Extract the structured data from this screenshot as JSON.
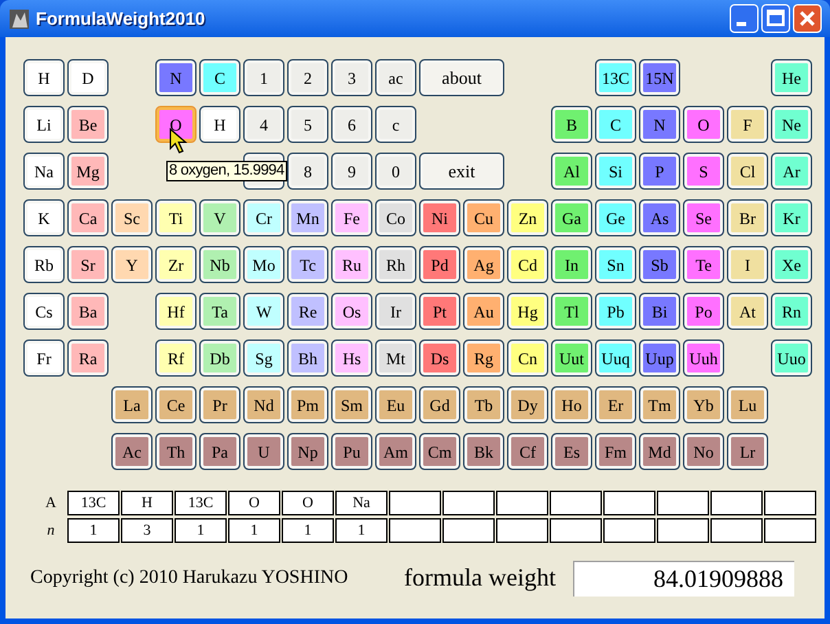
{
  "window": {
    "title": "FormulaWeight2010"
  },
  "button_rows": [
    [
      {
        "label": "H",
        "color": "#ffffff",
        "selected": false
      },
      {
        "label": "D",
        "color": "#ffffff",
        "selected": false
      },
      null,
      {
        "label": "N",
        "color": "#7878ff",
        "selected": false
      },
      {
        "label": "C",
        "color": "#70ffff",
        "selected": false
      },
      {
        "label": "1",
        "color": "#eeeeea",
        "selected": false
      },
      {
        "label": "2",
        "color": "#eeeeea",
        "selected": false
      },
      {
        "label": "3",
        "color": "#eeeeea",
        "selected": false
      },
      {
        "label": "ac",
        "color": "#eeeeea",
        "selected": false
      },
      {
        "label": "about",
        "kind": "wide",
        "color": "#f4f3ee",
        "selected": false
      },
      null,
      null,
      {
        "label": "13C",
        "color": "#70ffff",
        "selected": false
      },
      {
        "label": "15N",
        "color": "#7878ff",
        "selected": false
      },
      null,
      null,
      {
        "label": "He",
        "color": "#70ffd0",
        "selected": false
      }
    ],
    [
      {
        "label": "Li",
        "color": "#ffffff",
        "selected": false
      },
      {
        "label": "Be",
        "color": "#ffb8b8",
        "selected": false
      },
      null,
      {
        "label": "O",
        "color": "#ff70ff",
        "selected": true,
        "tooltip": "8 oxygen, 15.9994"
      },
      {
        "label": "H",
        "color": "#ffffff",
        "selected": false
      },
      {
        "label": "4",
        "color": "#eeeeea",
        "selected": false
      },
      {
        "label": "5",
        "color": "#eeeeea",
        "selected": false
      },
      {
        "label": "6",
        "color": "#eeeeea",
        "selected": false
      },
      {
        "label": "c",
        "color": "#eeeeea",
        "selected": false
      },
      null,
      null,
      null,
      {
        "label": "B",
        "color": "#70f070",
        "selected": false
      },
      {
        "label": "C",
        "color": "#70ffff",
        "selected": false
      },
      {
        "label": "N",
        "color": "#7878ff",
        "selected": false
      },
      {
        "label": "O",
        "color": "#ff70ff",
        "selected": false
      },
      {
        "label": "F",
        "color": "#f0e0a0",
        "selected": false
      },
      {
        "label": "Ne",
        "color": "#70ffd0",
        "selected": false
      }
    ],
    [
      {
        "label": "Na",
        "color": "#ffffff",
        "selected": false
      },
      {
        "label": "Mg",
        "color": "#ffb8b8",
        "selected": false
      },
      null,
      null,
      null,
      {
        "kind": "covered",
        "color": "#eeeeea",
        "selected": false
      },
      {
        "label": "8",
        "color": "#eeeeea",
        "selected": false
      },
      {
        "label": "9",
        "color": "#eeeeea",
        "selected": false
      },
      {
        "label": "0",
        "color": "#eeeeea",
        "selected": false
      },
      {
        "label": "exit",
        "kind": "wide",
        "color": "#f4f3ee",
        "selected": false
      },
      null,
      {
        "label": "Al",
        "color": "#70f070",
        "selected": false
      },
      {
        "label": "Si",
        "color": "#70ffff",
        "selected": false
      },
      {
        "label": "P",
        "color": "#7878ff",
        "selected": false
      },
      {
        "label": "S",
        "color": "#ff70ff",
        "selected": false
      },
      {
        "label": "Cl",
        "color": "#f0e0a0",
        "selected": false
      },
      {
        "label": "Ar",
        "color": "#70ffd0",
        "selected": false
      }
    ],
    [
      {
        "label": "K",
        "color": "#ffffff",
        "selected": false
      },
      {
        "label": "Ca",
        "color": "#ffb8b8",
        "selected": false
      },
      {
        "label": "Sc",
        "color": "#ffd8b0",
        "selected": false
      },
      {
        "label": "Ti",
        "color": "#ffffb0",
        "selected": false
      },
      {
        "label": "V",
        "color": "#b0f0b0",
        "selected": false
      },
      {
        "label": "Cr",
        "color": "#c0ffff",
        "selected": false
      },
      {
        "label": "Mn",
        "color": "#c0c0ff",
        "selected": false
      },
      {
        "label": "Fe",
        "color": "#ffc0ff",
        "selected": false
      },
      {
        "label": "Co",
        "color": "#e0e0e0",
        "selected": false
      },
      {
        "label": "Ni",
        "color": "#ff7878",
        "selected": false
      },
      {
        "label": "Cu",
        "color": "#ffb070",
        "selected": false
      },
      {
        "label": "Zn",
        "color": "#ffff80",
        "selected": false
      },
      {
        "label": "Ga",
        "color": "#70f070",
        "selected": false
      },
      {
        "label": "Ge",
        "color": "#70ffff",
        "selected": false
      },
      {
        "label": "As",
        "color": "#7878ff",
        "selected": false
      },
      {
        "label": "Se",
        "color": "#ff70ff",
        "selected": false
      },
      {
        "label": "Br",
        "color": "#f0e0a0",
        "selected": false
      },
      {
        "label": "Kr",
        "color": "#70ffd0",
        "selected": false
      }
    ],
    [
      {
        "label": "Rb",
        "color": "#ffffff",
        "selected": false
      },
      {
        "label": "Sr",
        "color": "#ffb8b8",
        "selected": false
      },
      {
        "label": "Y",
        "color": "#ffd8b0",
        "selected": false
      },
      {
        "label": "Zr",
        "color": "#ffffb0",
        "selected": false
      },
      {
        "label": "Nb",
        "color": "#b0f0b0",
        "selected": false
      },
      {
        "label": "Mo",
        "color": "#c0ffff",
        "selected": false
      },
      {
        "label": "Tc",
        "color": "#c0c0ff",
        "selected": false
      },
      {
        "label": "Ru",
        "color": "#ffc0ff",
        "selected": false
      },
      {
        "label": "Rh",
        "color": "#e0e0e0",
        "selected": false
      },
      {
        "label": "Pd",
        "color": "#ff7878",
        "selected": false
      },
      {
        "label": "Ag",
        "color": "#ffb070",
        "selected": false
      },
      {
        "label": "Cd",
        "color": "#ffff80",
        "selected": false
      },
      {
        "label": "In",
        "color": "#70f070",
        "selected": false
      },
      {
        "label": "Sn",
        "color": "#70ffff",
        "selected": false
      },
      {
        "label": "Sb",
        "color": "#7878ff",
        "selected": false
      },
      {
        "label": "Te",
        "color": "#ff70ff",
        "selected": false
      },
      {
        "label": "I",
        "color": "#f0e0a0",
        "selected": false
      },
      {
        "label": "Xe",
        "color": "#70ffd0",
        "selected": false
      }
    ],
    [
      {
        "label": "Cs",
        "color": "#ffffff",
        "selected": false
      },
      {
        "label": "Ba",
        "color": "#ffb8b8",
        "selected": false
      },
      null,
      {
        "label": "Hf",
        "color": "#ffffb0",
        "selected": false
      },
      {
        "label": "Ta",
        "color": "#b0f0b0",
        "selected": false
      },
      {
        "label": "W",
        "color": "#c0ffff",
        "selected": false
      },
      {
        "label": "Re",
        "color": "#c0c0ff",
        "selected": false
      },
      {
        "label": "Os",
        "color": "#ffc0ff",
        "selected": false
      },
      {
        "label": "Ir",
        "color": "#e0e0e0",
        "selected": false
      },
      {
        "label": "Pt",
        "color": "#ff7878",
        "selected": false
      },
      {
        "label": "Au",
        "color": "#ffb070",
        "selected": false
      },
      {
        "label": "Hg",
        "color": "#ffff80",
        "selected": false
      },
      {
        "label": "Tl",
        "color": "#70f070",
        "selected": false
      },
      {
        "label": "Pb",
        "color": "#70ffff",
        "selected": false
      },
      {
        "label": "Bi",
        "color": "#7878ff",
        "selected": false
      },
      {
        "label": "Po",
        "color": "#ff70ff",
        "selected": false
      },
      {
        "label": "At",
        "color": "#f0e0a0",
        "selected": false
      },
      {
        "label": "Rn",
        "color": "#70ffd0",
        "selected": false
      }
    ],
    [
      {
        "label": "Fr",
        "color": "#ffffff",
        "selected": false
      },
      {
        "label": "Ra",
        "color": "#ffb8b8",
        "selected": false
      },
      null,
      {
        "label": "Rf",
        "color": "#ffffb0",
        "selected": false
      },
      {
        "label": "Db",
        "color": "#b0f0b0",
        "selected": false
      },
      {
        "label": "Sg",
        "color": "#c0ffff",
        "selected": false
      },
      {
        "label": "Bh",
        "color": "#c0c0ff",
        "selected": false
      },
      {
        "label": "Hs",
        "color": "#ffc0ff",
        "selected": false
      },
      {
        "label": "Mt",
        "color": "#e0e0e0",
        "selected": false
      },
      {
        "label": "Ds",
        "color": "#ff7878",
        "selected": false
      },
      {
        "label": "Rg",
        "color": "#ffb070",
        "selected": false
      },
      {
        "label": "Cn",
        "color": "#ffff80",
        "selected": false
      },
      {
        "label": "Uut",
        "color": "#70f070",
        "selected": false
      },
      {
        "label": "Uuq",
        "color": "#70ffff",
        "selected": false
      },
      {
        "label": "Uup",
        "color": "#7878ff",
        "selected": false
      },
      {
        "label": "Uuh",
        "color": "#ff70ff",
        "selected": false
      },
      null,
      {
        "label": "Uuo",
        "color": "#70ffd0",
        "selected": false
      }
    ],
    [
      null,
      null,
      {
        "label": "La",
        "color": "#e0b880",
        "selected": false
      },
      {
        "label": "Ce",
        "color": "#e0b880",
        "selected": false
      },
      {
        "label": "Pr",
        "color": "#e0b880",
        "selected": false
      },
      {
        "label": "Nd",
        "color": "#e0b880",
        "selected": false
      },
      {
        "label": "Pm",
        "color": "#e0b880",
        "selected": false
      },
      {
        "label": "Sm",
        "color": "#e0b880",
        "selected": false
      },
      {
        "label": "Eu",
        "color": "#e0b880",
        "selected": false
      },
      {
        "label": "Gd",
        "color": "#e0b880",
        "selected": false
      },
      {
        "label": "Tb",
        "color": "#e0b880",
        "selected": false
      },
      {
        "label": "Dy",
        "color": "#e0b880",
        "selected": false
      },
      {
        "label": "Ho",
        "color": "#e0b880",
        "selected": false
      },
      {
        "label": "Er",
        "color": "#e0b880",
        "selected": false
      },
      {
        "label": "Tm",
        "color": "#e0b880",
        "selected": false
      },
      {
        "label": "Yb",
        "color": "#e0b880",
        "selected": false
      },
      {
        "label": "Lu",
        "color": "#e0b880",
        "selected": false
      }
    ],
    [
      null,
      null,
      {
        "label": "Ac",
        "color": "#b88888",
        "selected": false
      },
      {
        "label": "Th",
        "color": "#b88888",
        "selected": false
      },
      {
        "label": "Pa",
        "color": "#b88888",
        "selected": false
      },
      {
        "label": "U",
        "color": "#b88888",
        "selected": false
      },
      {
        "label": "Np",
        "color": "#b88888",
        "selected": false
      },
      {
        "label": "Pu",
        "color": "#b88888",
        "selected": false
      },
      {
        "label": "Am",
        "color": "#b88888",
        "selected": false
      },
      {
        "label": "Cm",
        "color": "#b88888",
        "selected": false
      },
      {
        "label": "Bk",
        "color": "#b88888",
        "selected": false
      },
      {
        "label": "Cf",
        "color": "#b88888",
        "selected": false
      },
      {
        "label": "Es",
        "color": "#b88888",
        "selected": false
      },
      {
        "label": "Fm",
        "color": "#b88888",
        "selected": false
      },
      {
        "label": "Md",
        "color": "#b88888",
        "selected": false
      },
      {
        "label": "No",
        "color": "#b88888",
        "selected": false
      },
      {
        "label": "Lr",
        "color": "#b88888",
        "selected": false
      }
    ]
  ],
  "formula_table": {
    "row_labels": [
      "A",
      "n"
    ],
    "atoms": [
      {
        "A": "13C",
        "n": "1"
      },
      {
        "A": "H",
        "n": "3"
      },
      {
        "A": "13C",
        "n": "1"
      },
      {
        "A": "O",
        "n": "1"
      },
      {
        "A": "O",
        "n": "1"
      },
      {
        "A": "Na",
        "n": "1"
      }
    ]
  },
  "copyright": "Copyright (c) 2010 Harukazu YOSHINO",
  "formula_weight": {
    "label": "formula weight",
    "value": "84.01909888"
  }
}
